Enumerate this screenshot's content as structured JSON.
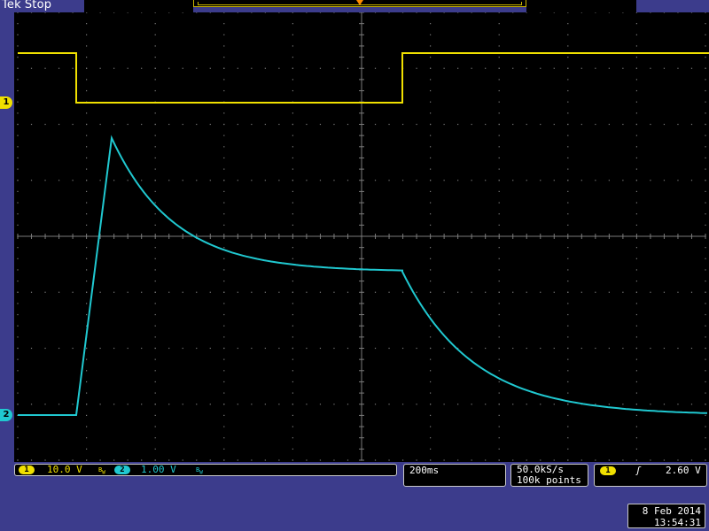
{
  "header": {
    "brand": "Tek",
    "status": "Stop"
  },
  "channels": [
    {
      "id": "1",
      "color": "#f0e000",
      "scale": "10.0 V",
      "coupling_symbol": "B_W"
    },
    {
      "id": "2",
      "color": "#20c8d0",
      "scale": "1.00 V",
      "coupling_symbol": "B_W"
    }
  ],
  "timebase": {
    "scale": "200ms"
  },
  "acquisition": {
    "sample_rate": "50.0kS/s",
    "record_length": "100k points"
  },
  "trigger": {
    "source": "1",
    "slope_symbol": "ʃ",
    "level": "2.60 V"
  },
  "datetime": {
    "date": "8 Feb  2014",
    "time": "13:54:31"
  },
  "colors": {
    "ch1": "#f0e000",
    "ch2": "#20c8d0",
    "grid": "#7a7a7a",
    "frame": "#3c3c8c"
  }
}
